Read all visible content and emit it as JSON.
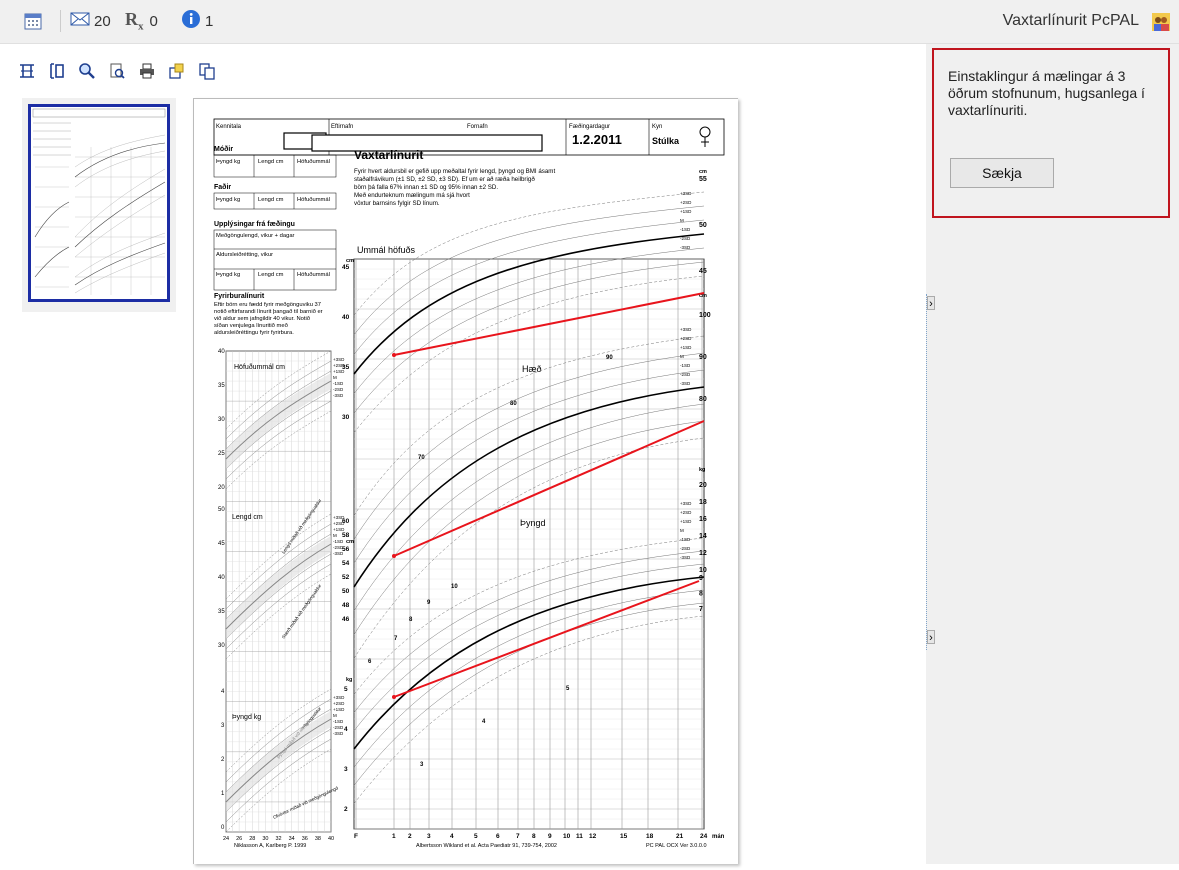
{
  "topbar": {
    "mail_count": "20",
    "rx_count": "0",
    "info_count": "1",
    "title": "Vaxtarlínurit PcPAL"
  },
  "notice": {
    "message": "Einstaklingur á mælingar á 3 öðrum stofnunum, hugsanlega í vaxtarlínuriti.",
    "button_label": "Sækja"
  },
  "chart": {
    "header_fields": {
      "kennitala_label": "Kennitala",
      "eftirnafn_label": "Eftirnafn",
      "fornafn_label": "Fornafn",
      "faedingardagur_label": "Fæðingardagur",
      "faedingardagur_value": "1.2.2011",
      "kyn_label": "Kyn",
      "kyn_value": "Stúlka"
    },
    "title": "Vaxtarlínurit",
    "description_lines": [
      "Fyrir hvert aldursbil er gefið upp meðaltal fyrir lengd, þyngd og BMI ásamt",
      "staðalfrávikum (±1 SD, ±2 SD, ±3 SD). Ef um er að ræða heilbrigð",
      "börn þá falla 67% innan ±1 SD og 95% innan ±2 SD.",
      "Með endurteknum mælingum má sjá hvort",
      "vöxtur barnsins fylgir SD línum."
    ],
    "mother_label": "Móðir",
    "father_label": "Faðir",
    "parent_cols": [
      "Þyngd kg",
      "Lengd cm",
      "Höfuðummál"
    ],
    "birth_info_label": "Upplýsingar frá fæðingu",
    "birth_rows": [
      "Meðgöngulengd, vikur + dagar",
      "Aldursleiðrétting, vikur"
    ],
    "prem_title": "Fyrirburalínurit",
    "prem_desc": [
      "Eftir börn eru fædd fyrir meðgönguviku 37",
      "notið eftirfarandi línurit þangað til barnið er",
      "við aldur sem jafngildir 40 vikur. Notið",
      "síðan venjulega línuritið með",
      "aldursleiðréttingu fyrir fyrirbura."
    ],
    "left_labels": {
      "head": "Höfuðummál cm",
      "length": "Lengd cm",
      "weight": "Þyngd kg",
      "diag1": "Lengd miðað við meðgöngualdur",
      "diag2": "Stærð miðað við meðgöngualdur",
      "diag3": "Þyngd miðað við meðgöngualdur",
      "diag4": "Ofvöxtur miðað við meðgöngulengd"
    },
    "left_xticks": [
      "24",
      "26",
      "28",
      "30",
      "32",
      "34",
      "36",
      "38",
      "40"
    ],
    "left_y_head": [
      "40",
      "35",
      "30",
      "25",
      "20"
    ],
    "left_y_len": [
      "50",
      "45",
      "40",
      "35",
      "30"
    ],
    "left_y_wt": [
      "4",
      "3",
      "2",
      "1",
      "0"
    ],
    "left_credit": "Niklasson A, Karlberg P. 1999",
    "head_label": "Ummál höfuðs",
    "height_label": "Hæð",
    "weight_label": "Þyngd",
    "unit_cm": "cm",
    "unit_kg": "kg",
    "head_y_left": [
      "45",
      "40",
      "35",
      "30"
    ],
    "height_y_left": [
      "60",
      "58",
      "56",
      "54",
      "52",
      "50",
      "48",
      "46"
    ],
    "weight_y_left": [
      "5",
      "4",
      "3",
      "2"
    ],
    "right_head_axis": [
      "55",
      "50",
      "45"
    ],
    "right_height_axis": [
      "100",
      "90",
      "80"
    ],
    "right_weight_axis": [
      "20",
      "18",
      "16",
      "14",
      "12",
      "10",
      "9",
      "8",
      "7"
    ],
    "inner_height": [
      "90",
      "80",
      "70"
    ],
    "inner_weight": [
      "10",
      "9",
      "8",
      "7",
      "6",
      "5",
      "4",
      "3"
    ],
    "sd_labels": [
      "+3SD",
      "+2SD",
      "+1SD",
      "M",
      "-1SD",
      "-2SD",
      "-3SD"
    ],
    "x_ticks": [
      "F",
      "1",
      "2",
      "3",
      "4",
      "5",
      "6",
      "7",
      "8",
      "9",
      "10",
      "11",
      "12",
      "15",
      "18",
      "21",
      "24"
    ],
    "x_unit": "mán",
    "bottom_credit": "Albertsson Wikland et al. Acta Paediatr 91, 739-754, 2002",
    "version": "PC PAL OCX Ver 3.0.0.0"
  },
  "colors": {
    "notice_border": "#c0141e",
    "measurement_line": "#e8141c",
    "thumb_border": "#1c2da4"
  },
  "icons": [
    "calendar-icon",
    "mail-icon",
    "rx-icon",
    "info-icon",
    "user-icon"
  ]
}
